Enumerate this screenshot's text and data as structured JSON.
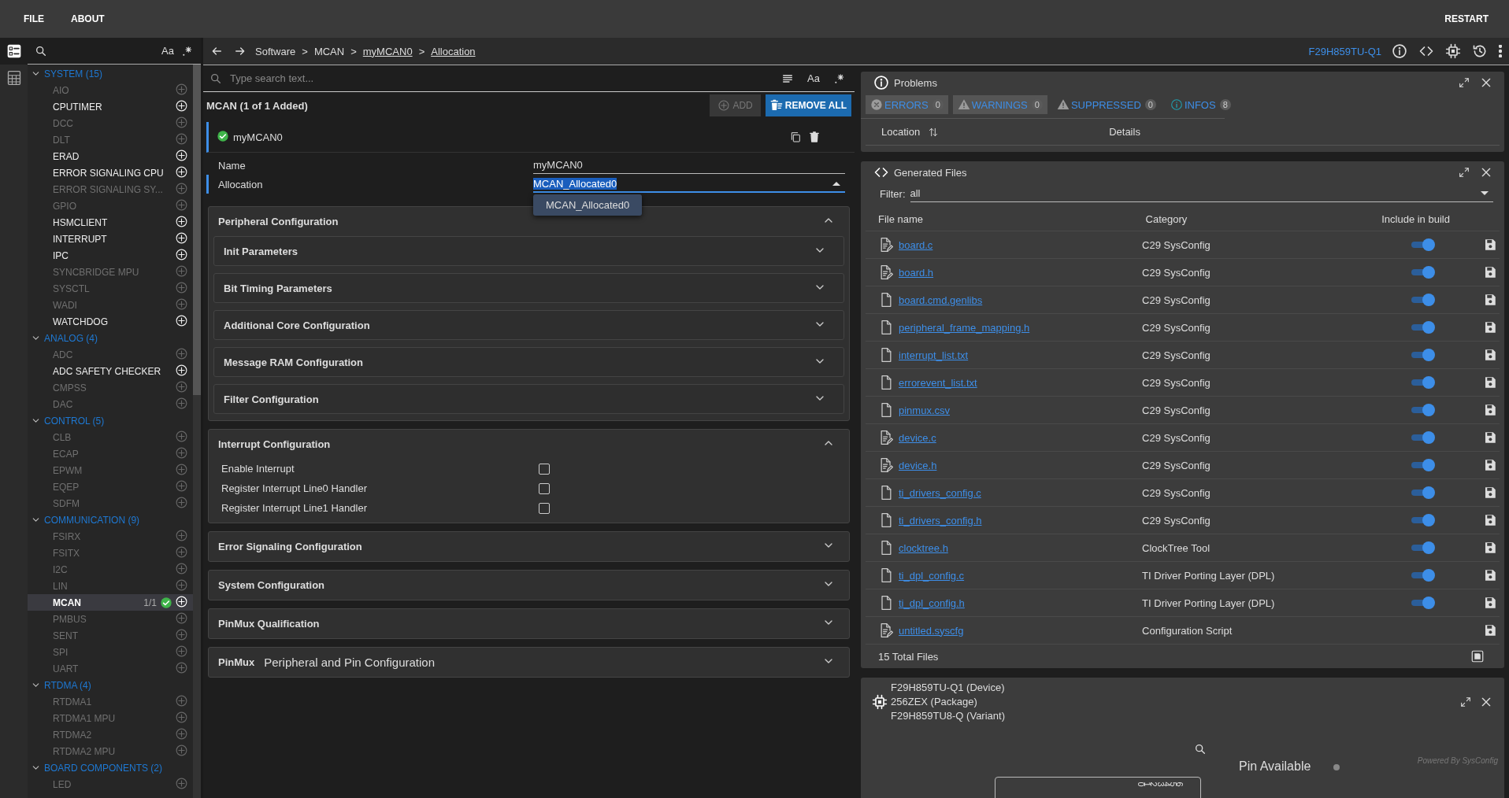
{
  "menu": {
    "left": [
      {
        "label": "FILE"
      },
      {
        "label": "ABOUT"
      }
    ],
    "right": [
      {
        "label": "RESTART"
      }
    ]
  },
  "sidebar": {
    "case_label": "Aa"
  },
  "groups": [
    {
      "title": "SYSTEM (15)",
      "expanded": true,
      "items": [
        {
          "label": "AIO",
          "disabled": true,
          "selected": false
        },
        {
          "label": "CPUTIMER",
          "disabled": false,
          "selected": false
        },
        {
          "label": "DCC",
          "disabled": true,
          "selected": false
        },
        {
          "label": "DLT",
          "disabled": true,
          "selected": false
        },
        {
          "label": "ERAD",
          "disabled": false,
          "selected": false
        },
        {
          "label": "ERROR SIGNALING CPU",
          "disabled": false,
          "selected": false
        },
        {
          "label": "ERROR SIGNALING SY...",
          "disabled": true,
          "selected": false
        },
        {
          "label": "GPIO",
          "disabled": true,
          "selected": false
        },
        {
          "label": "HSMCLIENT",
          "disabled": false,
          "selected": false
        },
        {
          "label": "INTERRUPT",
          "disabled": false,
          "selected": false
        },
        {
          "label": "IPC",
          "disabled": false,
          "selected": false
        },
        {
          "label": "SYNCBRIDGE MPU",
          "disabled": true,
          "selected": false
        },
        {
          "label": "SYSCTL",
          "disabled": true,
          "selected": false
        },
        {
          "label": "WADI",
          "disabled": true,
          "selected": false
        },
        {
          "label": "WATCHDOG",
          "disabled": false,
          "selected": false
        }
      ]
    },
    {
      "title": "ANALOG (4)",
      "expanded": true,
      "items": [
        {
          "label": "ADC",
          "disabled": true,
          "selected": false
        },
        {
          "label": "ADC SAFETY CHECKER",
          "disabled": false,
          "selected": false
        },
        {
          "label": "CMPSS",
          "disabled": true,
          "selected": false
        },
        {
          "label": "DAC",
          "disabled": true,
          "selected": false
        }
      ]
    },
    {
      "title": "CONTROL (5)",
      "expanded": true,
      "items": [
        {
          "label": "CLB",
          "disabled": true,
          "selected": false
        },
        {
          "label": "ECAP",
          "disabled": true,
          "selected": false
        },
        {
          "label": "EPWM",
          "disabled": true,
          "selected": false
        },
        {
          "label": "EQEP",
          "disabled": true,
          "selected": false
        },
        {
          "label": "SDFM",
          "disabled": true,
          "selected": false
        }
      ]
    },
    {
      "title": "COMMUNICATION (9)",
      "expanded": true,
      "items": [
        {
          "label": "FSIRX",
          "disabled": true,
          "selected": false
        },
        {
          "label": "FSITX",
          "disabled": true,
          "selected": false
        },
        {
          "label": "I2C",
          "disabled": true,
          "selected": false
        },
        {
          "label": "LIN",
          "disabled": true,
          "selected": false
        },
        {
          "label": "MCAN",
          "disabled": false,
          "selected": true,
          "count": "1/1",
          "valid": true
        },
        {
          "label": "PMBUS",
          "disabled": true,
          "selected": false
        },
        {
          "label": "SENT",
          "disabled": true,
          "selected": false
        },
        {
          "label": "SPI",
          "disabled": true,
          "selected": false
        },
        {
          "label": "UART",
          "disabled": true,
          "selected": false
        }
      ]
    },
    {
      "title": "RTDMA (4)",
      "expanded": true,
      "items": [
        {
          "label": "RTDMA1",
          "disabled": true,
          "selected": false
        },
        {
          "label": "RTDMA1 MPU",
          "disabled": true,
          "selected": false
        },
        {
          "label": "RTDMA2",
          "disabled": true,
          "selected": false
        },
        {
          "label": "RTDMA2 MPU",
          "disabled": true,
          "selected": false
        }
      ]
    },
    {
      "title": "BOARD COMPONENTS (2)",
      "expanded": true,
      "items": [
        {
          "label": "LED",
          "disabled": true,
          "selected": false
        }
      ]
    }
  ],
  "breadcrumb": {
    "separator": ">",
    "items": [
      {
        "label": "Software",
        "link": false
      },
      {
        "label": "MCAN",
        "link": false
      },
      {
        "label": "myMCAN0",
        "link": true
      },
      {
        "label": "Allocation",
        "link": true
      }
    ]
  },
  "device_link": "F29H859TU-Q1",
  "module": {
    "search_placeholder": "Type search text...",
    "case_label": "Aa",
    "title": "MCAN (1 of 1 Added)",
    "add_label": "ADD",
    "add_disabled": true,
    "remove_all_label": "REMOVE ALL",
    "instance": {
      "name": "myMCAN0",
      "valid": true
    },
    "fields": [
      {
        "kind": "text",
        "label": "Name",
        "value": "myMCAN0",
        "focused": false
      },
      {
        "kind": "select",
        "label": "Allocation",
        "value": "MCAN_Allocated0",
        "focused": true,
        "open": true,
        "options": [
          "MCAN_Allocated0"
        ]
      }
    ],
    "sections": [
      {
        "title": "Peripheral Configuration",
        "expanded": true,
        "subsections": [
          {
            "title": "Init Parameters",
            "expanded": false
          },
          {
            "title": "Bit Timing Parameters",
            "expanded": false
          },
          {
            "title": "Additional Core Configuration",
            "expanded": false
          },
          {
            "title": "Message RAM Configuration",
            "expanded": false
          },
          {
            "title": "Filter Configuration",
            "expanded": false
          }
        ]
      },
      {
        "title": "Interrupt Configuration",
        "expanded": true,
        "options": [
          {
            "label": "Enable Interrupt",
            "checked": false
          },
          {
            "label": "Register Interrupt Line0 Handler",
            "checked": false
          },
          {
            "label": "Register Interrupt Line1 Handler",
            "checked": false
          }
        ]
      },
      {
        "title": "Error Signaling Configuration",
        "expanded": false
      },
      {
        "title": "System Configuration",
        "expanded": false
      },
      {
        "title": "PinMux Qualification",
        "expanded": false
      },
      {
        "tag": "PinMux",
        "title": "Peripheral and Pin Configuration",
        "expanded": false
      }
    ]
  },
  "problems": {
    "title": "Problems",
    "filters": [
      {
        "kind": "error",
        "label": "ERRORS",
        "count": "0",
        "selected": true
      },
      {
        "kind": "warning",
        "label": "WARNINGS",
        "count": "0",
        "selected": true
      },
      {
        "kind": "suppressed",
        "label": "SUPPRESSED",
        "count": "0",
        "selected": false
      },
      {
        "kind": "info",
        "label": "INFOS",
        "count": "8",
        "selected": false
      }
    ],
    "columns": [
      "Location",
      "Details"
    ]
  },
  "files": {
    "title": "Generated Files",
    "filter_label": "Filter:",
    "filter_value": "all",
    "columns": [
      "File name",
      "Category",
      "Include in build"
    ],
    "rows": [
      {
        "kind": "edited",
        "name": "board.c",
        "category": "C29 SysConfig",
        "include_in_build": true
      },
      {
        "kind": "edited",
        "name": "board.h",
        "category": "C29 SysConfig",
        "include_in_build": true
      },
      {
        "kind": "plain",
        "name": "board.cmd.genlibs",
        "category": "C29 SysConfig",
        "include_in_build": true
      },
      {
        "kind": "plain",
        "name": "peripheral_frame_mapping.h",
        "category": "C29 SysConfig",
        "include_in_build": true
      },
      {
        "kind": "plain",
        "name": "interrupt_list.txt",
        "category": "C29 SysConfig",
        "include_in_build": true
      },
      {
        "kind": "plain",
        "name": "errorevent_list.txt",
        "category": "C29 SysConfig",
        "include_in_build": true
      },
      {
        "kind": "plain",
        "name": "pinmux.csv",
        "category": "C29 SysConfig",
        "include_in_build": true
      },
      {
        "kind": "edited",
        "name": "device.c",
        "category": "C29 SysConfig",
        "include_in_build": true
      },
      {
        "kind": "edited",
        "name": "device.h",
        "category": "C29 SysConfig",
        "include_in_build": true
      },
      {
        "kind": "plain",
        "name": "ti_drivers_config.c",
        "category": "C29 SysConfig",
        "include_in_build": true
      },
      {
        "kind": "plain",
        "name": "ti_drivers_config.h",
        "category": "C29 SysConfig",
        "include_in_build": true
      },
      {
        "kind": "plain",
        "name": "clocktree.h",
        "category": "ClockTree Tool",
        "include_in_build": true
      },
      {
        "kind": "plain",
        "name": "ti_dpl_config.c",
        "category": "TI Driver Porting Layer (DPL)",
        "include_in_build": true
      },
      {
        "kind": "plain",
        "name": "ti_dpl_config.h",
        "category": "TI Driver Porting Layer (DPL)",
        "include_in_build": true
      },
      {
        "kind": "edited",
        "name": "untitled.syscfg",
        "category": "Configuration Script"
      }
    ],
    "total": "15 Total Files"
  },
  "device": {
    "lines": [
      "F29H859TU-Q1 (Device)",
      "256ZEX (Package)",
      "F29H859TU8-Q (Variant)"
    ],
    "pin_labels": [
      "0",
      "1",
      "2",
      "3",
      "4",
      "5",
      "6"
    ],
    "legend": "Pin Available",
    "powered_by": "Powered By SysConfig"
  }
}
